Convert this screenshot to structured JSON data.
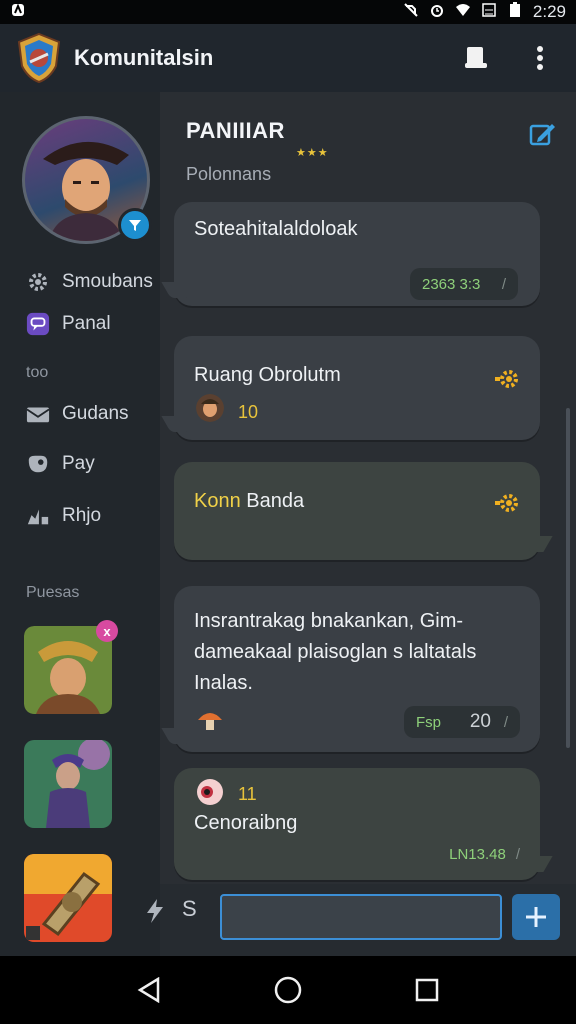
{
  "status_bar": {
    "time": "2:29",
    "left_icon": "android-icon",
    "icons": [
      "mute-icon",
      "alarm-icon",
      "wifi-icon",
      "signal-icon",
      "battery-icon"
    ]
  },
  "app_bar": {
    "title": "Komunitalsin",
    "logo": "shield-logo-icon",
    "actions": [
      "device-icon",
      "more-vert-icon"
    ]
  },
  "sidebar": {
    "profile_badge": "filter-icon",
    "items": [
      {
        "label": "Smoubans",
        "icon": "gear-icon"
      },
      {
        "label": "Panal",
        "icon": "chat-bubble-icon"
      }
    ],
    "caption_1": "too",
    "items_2": [
      {
        "label": "Gudans",
        "icon": "mail-icon"
      },
      {
        "label": "Pay",
        "icon": "game-icon"
      },
      {
        "label": "Rhjo",
        "icon": "chart-icon"
      }
    ],
    "caption_2": "Puesas",
    "tiles": [
      "game-tile-warrior",
      "game-tile-forest",
      "game-tile-rocket"
    ]
  },
  "panel": {
    "title": "PANIIIAR",
    "stars": "★★★",
    "subtitle": "Polonnans",
    "edit_icon": "edit-icon"
  },
  "cards": [
    {
      "title": "Soteahitalaldoloak",
      "pill": "2363 3:3",
      "pill_check": "/"
    },
    {
      "title": "Ruang Obrolutm",
      "count": "10"
    },
    {
      "title_colored": "Konn",
      "title_rest": " Banda"
    },
    {
      "body": "Insrantrakag bnakankan, Gim-dameakaal plaisoglan s laltatals Inalas.",
      "pill": "Fsp",
      "pill_num": "20",
      "pill_check": "/"
    },
    {
      "count": "11",
      "body": "Cenoraibng",
      "stamp": "LN13.48",
      "stamp_check": "/"
    }
  ],
  "composer": {
    "left_icon": "bolt-icon",
    "s_label": "S",
    "input_value": "",
    "input_placeholder": "",
    "send_icon": "plus-icon"
  },
  "nav": [
    "back-icon",
    "home-icon",
    "recents-icon"
  ],
  "colors": {
    "accent": "#3c8fd6",
    "badge": "#1d8fd0",
    "star": "#e8c33b",
    "green_text": "#8ed07a"
  }
}
